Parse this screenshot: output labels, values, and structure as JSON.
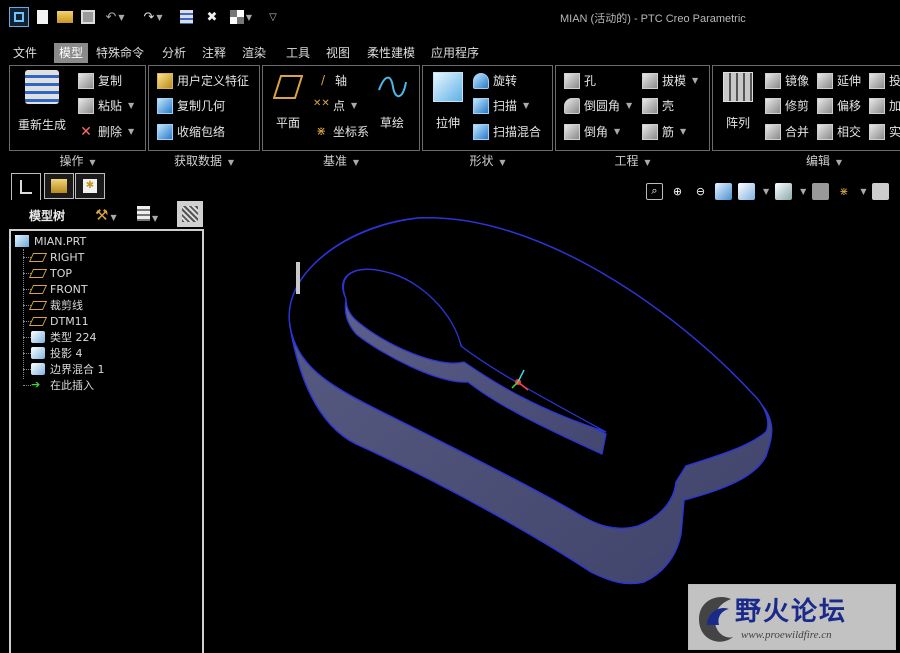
{
  "window": {
    "title": "MIAN (活动的) - PTC Creo Parametric"
  },
  "menu": {
    "items": [
      "文件",
      "模型",
      "特殊命令",
      "分析",
      "注释",
      "渲染",
      "工具",
      "视图",
      "柔性建模",
      "应用程序"
    ],
    "active_index": 1
  },
  "ribbon": {
    "operations": {
      "label": "操作",
      "regenerate": "重新生成",
      "copy": "复制",
      "paste": "粘贴",
      "delete": "删除"
    },
    "get_data": {
      "label": "获取数据",
      "udf": "用户定义特征",
      "copy_geometry": "复制几何",
      "shrinkwrap": "收缩包络"
    },
    "datum": {
      "label": "基准",
      "plane": "平面",
      "axis": "轴",
      "point": "点",
      "csys": "坐标系",
      "sketch": "草绘"
    },
    "shapes": {
      "label": "形状",
      "extrude": "拉伸",
      "revolve": "旋转",
      "sweep": "扫描",
      "swept_blend": "扫描混合"
    },
    "engineering": {
      "label": "工程",
      "hole": "孔",
      "round": "倒圆角",
      "chamfer": "倒角",
      "draft": "拔模",
      "shell": "壳",
      "rib": "筋"
    },
    "editing": {
      "label": "编辑",
      "pattern": "阵列",
      "mirror": "镜像",
      "trim": "修剪",
      "merge": "合并",
      "extend": "延伸",
      "offset": "偏移",
      "intersect": "相交",
      "project": "投",
      "thicken": "加",
      "solidify": "实"
    }
  },
  "model_tree": {
    "title": "模型树",
    "items": [
      {
        "label": "MIAN.PRT",
        "icon": "part-icon"
      },
      {
        "label": "RIGHT",
        "icon": "datum-plane-icon"
      },
      {
        "label": "TOP",
        "icon": "datum-plane-icon"
      },
      {
        "label": "FRONT",
        "icon": "datum-plane-icon"
      },
      {
        "label": "裁剪线",
        "icon": "datum-plane-icon"
      },
      {
        "label": "DTM11",
        "icon": "datum-plane-icon"
      },
      {
        "label": "类型 224",
        "icon": "surface-icon"
      },
      {
        "label": "投影 4",
        "icon": "projection-icon"
      },
      {
        "label": "边界混合 1",
        "icon": "boundary-blend-icon"
      },
      {
        "label": "在此插入",
        "icon": "insert-here-arrow-icon"
      }
    ]
  },
  "watermark": {
    "text": "野火论坛",
    "url": "www.proewildfire.cn"
  },
  "colors": {
    "surface": "#5a5e8c",
    "edge": "#2b35d6",
    "menu_active": "#8a8a8a"
  }
}
